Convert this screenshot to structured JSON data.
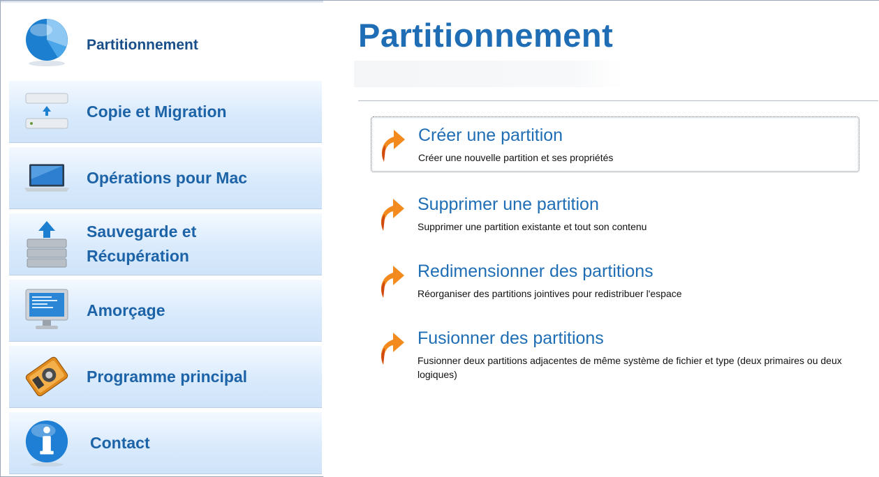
{
  "sidebar": {
    "items": [
      {
        "label": "Partitionnement",
        "icon": "partition-pie-icon"
      },
      {
        "label": "Copie et Migration",
        "icon": "disk-copy-icon"
      },
      {
        "label": "Opérations pour Mac",
        "icon": "macbook-laptop-icon"
      },
      {
        "label": "Sauvegarde et Récupération",
        "icon": "backup-database-icon"
      },
      {
        "label": "Amorçage",
        "icon": "boot-monitor-icon"
      },
      {
        "label": "Programme principal",
        "icon": "main-program-disk-icon"
      },
      {
        "label": "Contact",
        "icon": "info-icon"
      }
    ]
  },
  "main": {
    "title": "Partitionnement",
    "actions": [
      {
        "title": "Créer une partition",
        "description": "Créer une nouvelle partition et ses propriétés"
      },
      {
        "title": "Supprimer une partition",
        "description": "Supprimer une partition existante et tout son contenu"
      },
      {
        "title": "Redimensionner des partitions",
        "description": "Réorganiser des partitions jointives pour redistribuer l'espace"
      },
      {
        "title": "Fusionner des partitions",
        "description": "Fusionner deux partitions adjacentes de même système de fichier et type (deux primaires ou deux logiques)"
      }
    ]
  },
  "colors": {
    "accent": "#1f6eb5",
    "sidebar_bg": "#d9eafc",
    "arrow": "#f28a1e"
  }
}
